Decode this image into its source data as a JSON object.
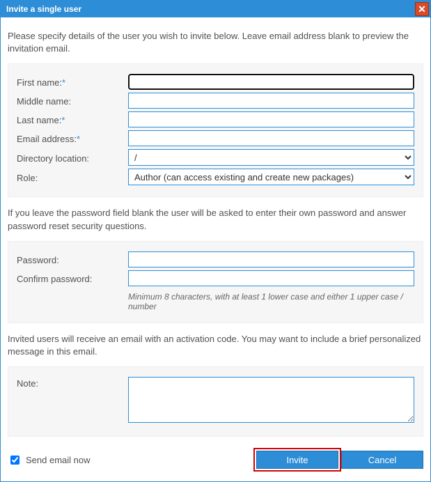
{
  "title": "Invite a single user",
  "intro": "Please specify details of the user you wish to invite below. Leave email address blank to preview the invitation email.",
  "labels": {
    "first_name": "First name:",
    "middle_name": "Middle name:",
    "last_name": "Last name:",
    "email": "Email address:",
    "directory": "Directory location:",
    "role": "Role:",
    "password": "Password:",
    "confirm_password": "Confirm password:",
    "note": "Note:"
  },
  "required_mark": "*",
  "values": {
    "first_name": "",
    "middle_name": "",
    "last_name": "",
    "email": "",
    "directory": "/",
    "role": "Author (can access existing and create new packages)",
    "password": "",
    "confirm_password": "",
    "note": ""
  },
  "password_intro": "If you leave the password field blank the user will be asked to enter their own password and answer password reset security questions.",
  "password_hint": "Minimum 8 characters, with at least 1 lower case and either 1 upper case / number",
  "note_intro": "Invited users will receive an email with an activation code. You may want to include a brief personalized message in this email.",
  "send_now_label": "Send email now",
  "send_now_checked": true,
  "buttons": {
    "invite": "Invite",
    "cancel": "Cancel"
  }
}
